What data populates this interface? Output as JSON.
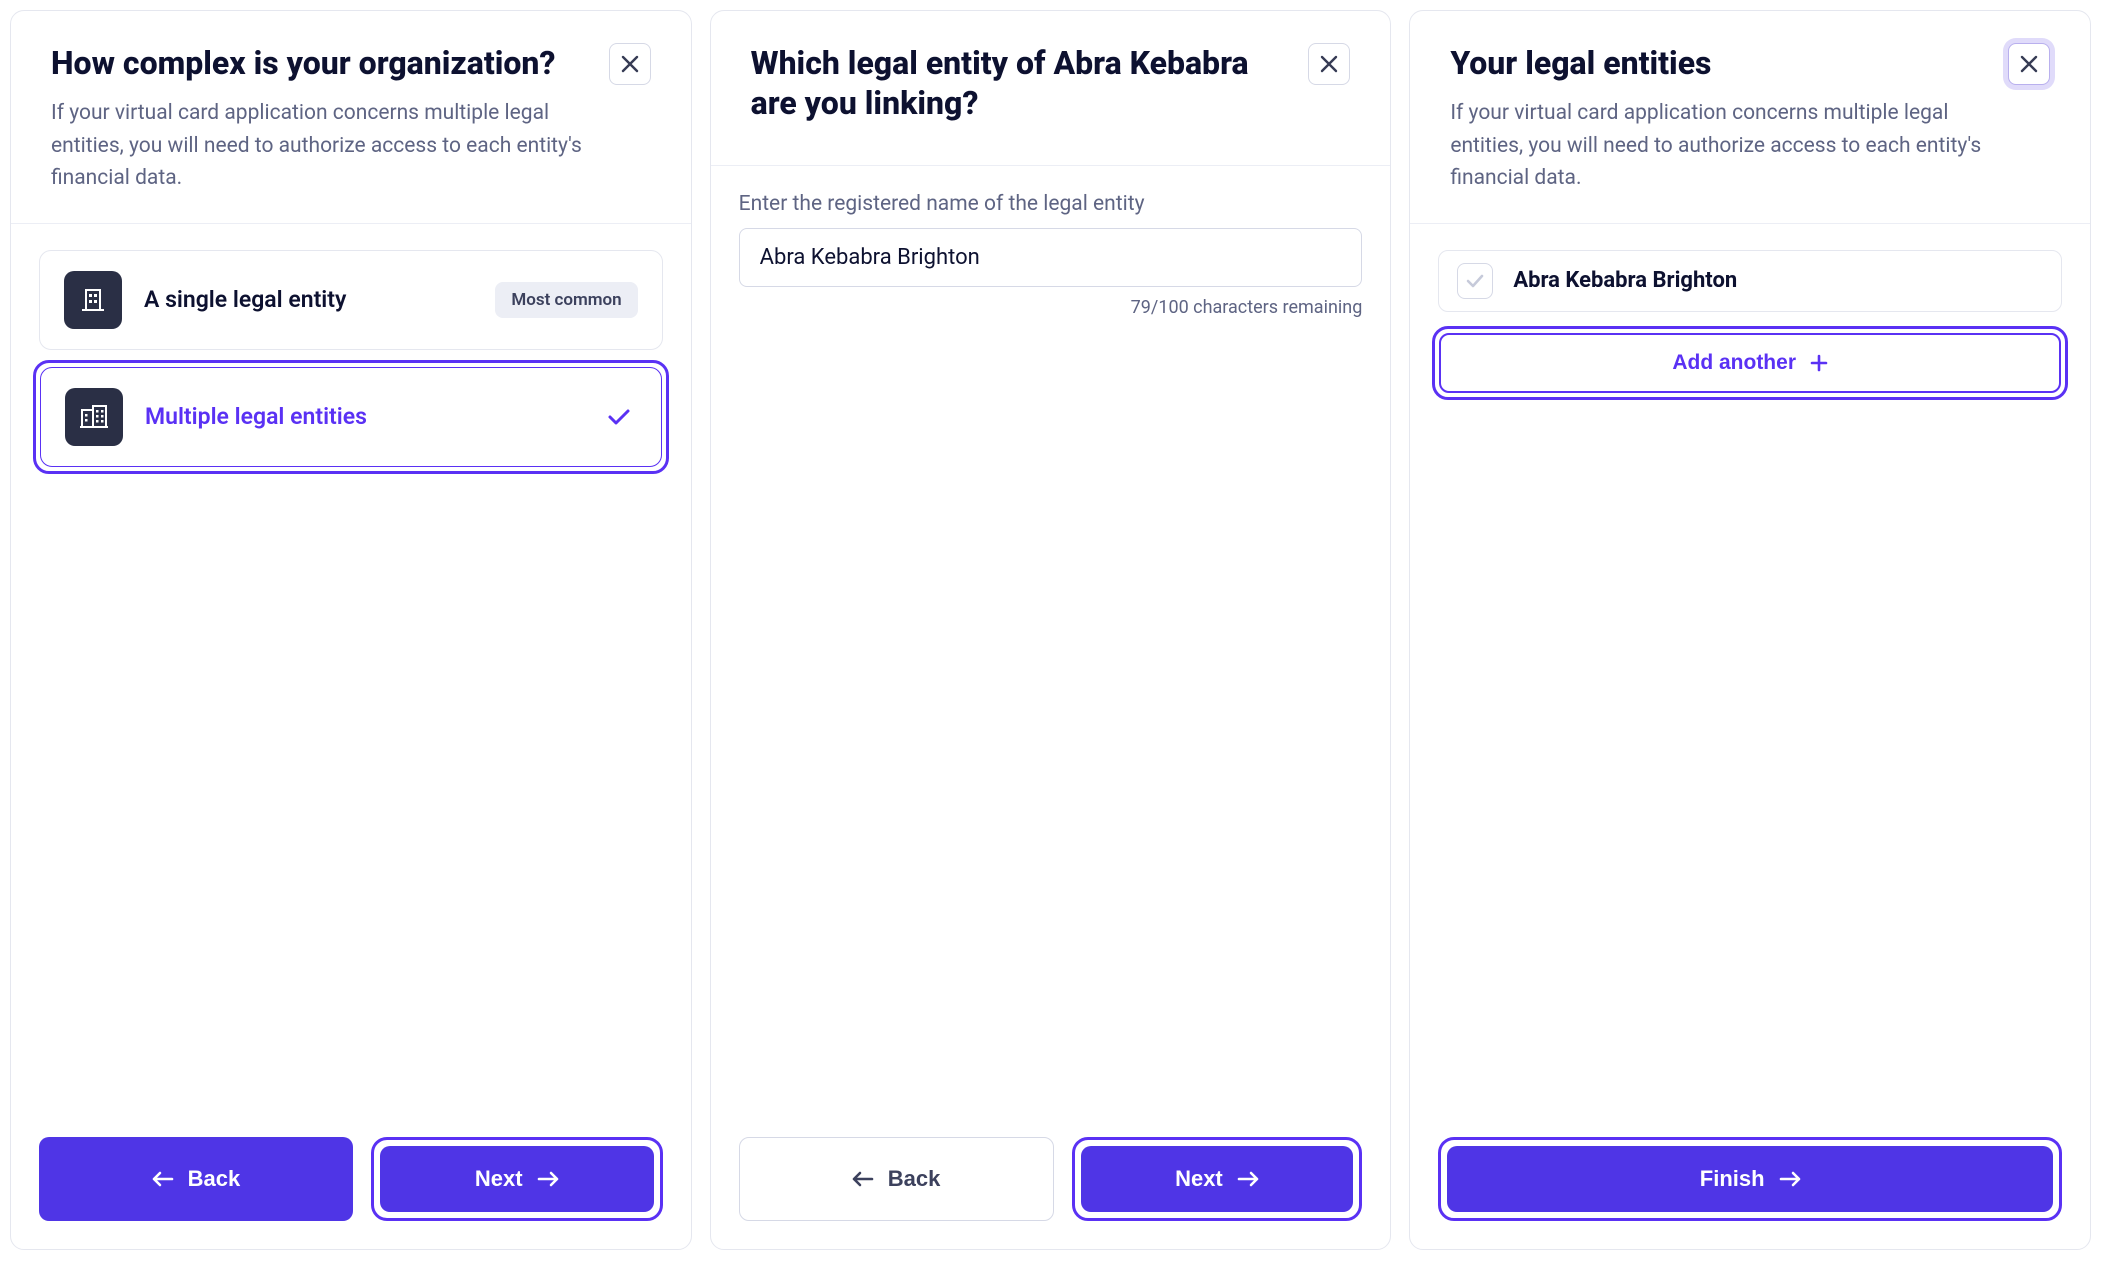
{
  "panel1": {
    "title": "How complex is your organization?",
    "subtitle": "If your virtual card application concerns multiple legal entities, you will need to authorize access to each entity's financial data.",
    "option_single": "A single legal entity",
    "option_single_badge": "Most common",
    "option_multiple": "Multiple legal entities",
    "back_label": "Back",
    "next_label": "Next"
  },
  "panel2": {
    "title": "Which legal entity of Abra Kebabra are you linking?",
    "field_label": "Enter the registered name of the legal entity",
    "input_value": "Abra Kebabra Brighton",
    "helper": "79/100 characters remaining",
    "back_label": "Back",
    "next_label": "Next"
  },
  "panel3": {
    "title": "Your legal entities",
    "subtitle": "If your virtual card application concerns multiple legal entities, you will need to authorize access to each entity's financial data.",
    "entity_name": "Abra Kebabra Brighton",
    "add_label": "Add another",
    "finish_label": "Finish"
  }
}
